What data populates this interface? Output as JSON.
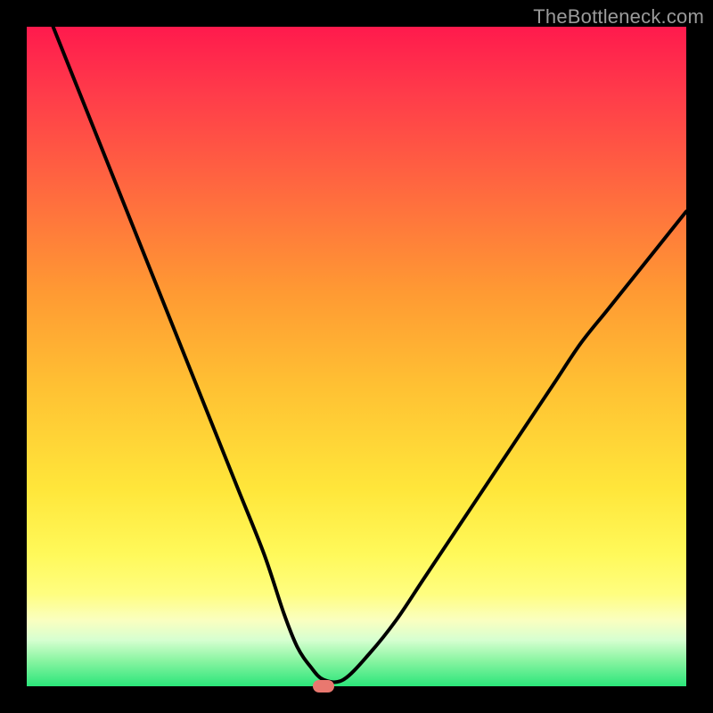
{
  "watermark": "TheBottleneck.com",
  "colors": {
    "background": "#000000",
    "watermark_text": "#9a9a9a",
    "curve": "#000000",
    "marker": "#e9786f",
    "gradient_top": "#ff1a4d",
    "gradient_bottom": "#2be57a"
  },
  "chart_data": {
    "type": "line",
    "title": "",
    "xlabel": "",
    "ylabel": "",
    "xlim": [
      0,
      100
    ],
    "ylim": [
      0,
      100
    ],
    "grid": false,
    "legend": false,
    "annotations": [
      "TheBottleneck.com"
    ],
    "gradient_description": "vertical gradient from red/pink (top) through orange and yellow to green (bottom)",
    "series": [
      {
        "name": "bottleneck-curve",
        "x": [
          4,
          8,
          12,
          16,
          20,
          24,
          28,
          32,
          36,
          39,
          41,
          43,
          45,
          48,
          52,
          56,
          60,
          64,
          68,
          72,
          76,
          80,
          84,
          88,
          92,
          96,
          100
        ],
        "y": [
          100,
          90,
          80,
          70,
          60,
          50,
          40,
          30,
          20,
          11,
          6,
          3,
          1,
          1,
          5,
          10,
          16,
          22,
          28,
          34,
          40,
          46,
          52,
          57,
          62,
          67,
          72
        ]
      }
    ],
    "marker": {
      "x": 45,
      "y": 0,
      "label": "optimal-point"
    }
  }
}
